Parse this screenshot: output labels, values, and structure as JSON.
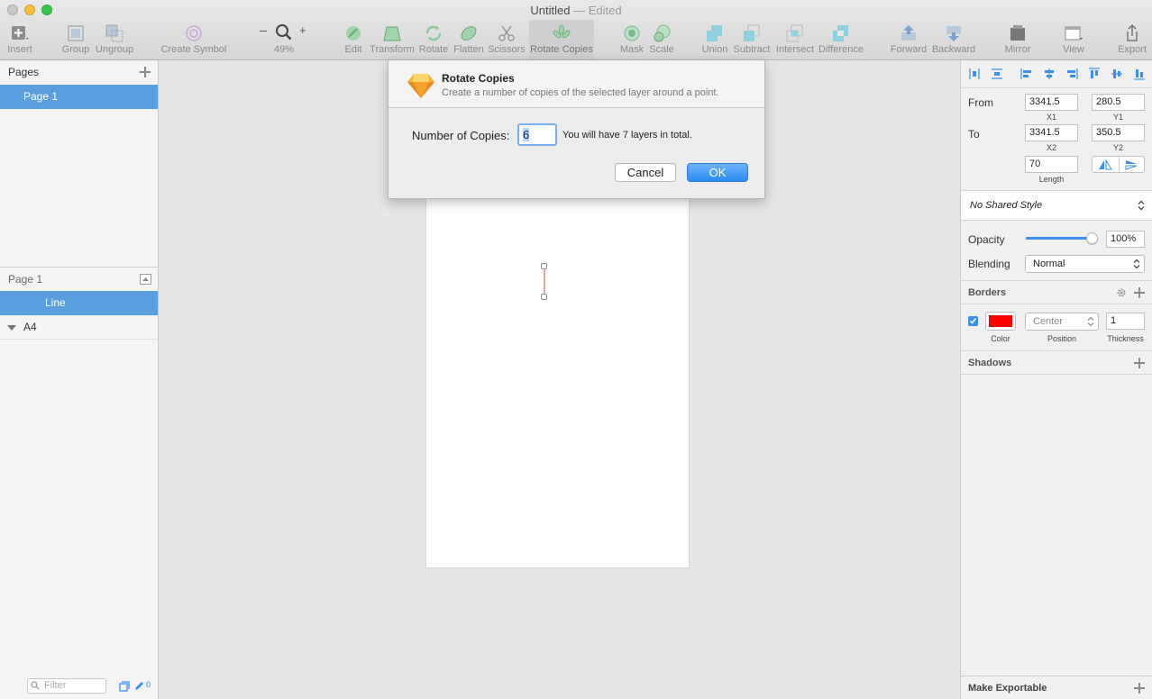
{
  "window": {
    "title": "Untitled",
    "edited": "— Edited"
  },
  "toolbar": {
    "insert": "Insert",
    "group": "Group",
    "ungroup": "Ungroup",
    "create_symbol": "Create Symbol",
    "zoom": "49%",
    "zoom_minus": "–",
    "zoom_plus": "+",
    "edit": "Edit",
    "transform": "Transform",
    "rotate": "Rotate",
    "flatten": "Flatten",
    "scissors": "Scissors",
    "rotate_copies": "Rotate Copies",
    "mask": "Mask",
    "scale": "Scale",
    "union": "Union",
    "subtract": "Subtract",
    "intersect": "Intersect",
    "difference": "Difference",
    "forward": "Forward",
    "backward": "Backward",
    "mirror": "Mirror",
    "view": "View",
    "export": "Export"
  },
  "pages_panel": {
    "header": "Pages",
    "pages": [
      "Page 1"
    ]
  },
  "layers_panel": {
    "header": "Page 1",
    "layers": [
      "Line",
      "A4"
    ]
  },
  "filter": {
    "placeholder": "Filter",
    "count": "0"
  },
  "dialog": {
    "title": "Rotate Copies",
    "subtitle": "Create a number of copies of the selected layer around a point.",
    "label": "Number of Copies:",
    "value": "6",
    "note": "You will have 7 layers in total.",
    "cancel": "Cancel",
    "ok": "OK"
  },
  "inspector": {
    "from_label": "From",
    "to_label": "To",
    "x1": "3341.5",
    "y1": "280.5",
    "x2": "3341.5",
    "y2": "350.5",
    "x1_label": "X1",
    "y1_label": "Y1",
    "x2_label": "X2",
    "y2_label": "Y2",
    "length": "70",
    "length_label": "Length",
    "shared_style": "No Shared Style",
    "opacity_label": "Opacity",
    "opacity": "100%",
    "opacity_fraction": 1.0,
    "blending_label": "Blending",
    "blending": "Normal",
    "borders_header": "Borders",
    "border_color": "#ff0000",
    "border_position": "Center",
    "border_thickness": "1",
    "color_label": "Color",
    "position_label": "Position",
    "thickness_label": "Thickness",
    "shadows_header": "Shadows",
    "make_exportable": "Make Exportable"
  }
}
